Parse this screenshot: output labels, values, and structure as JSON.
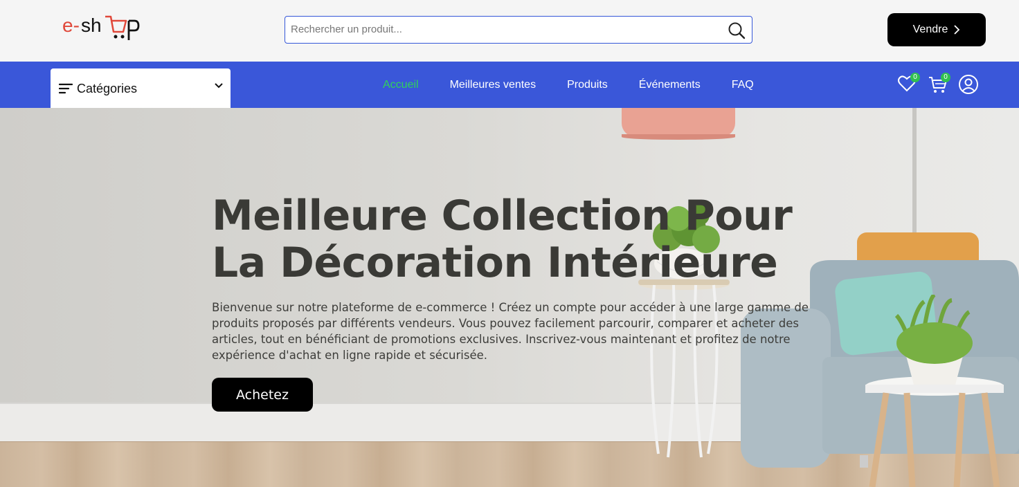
{
  "header": {
    "logo_text": "e-shop",
    "search": {
      "placeholder": "Rechercher un produit..."
    },
    "sell_label": "Vendre"
  },
  "nav": {
    "categories_label": "Catégories",
    "links": [
      {
        "label": "Accueil",
        "active": true
      },
      {
        "label": "Meilleures ventes",
        "active": false
      },
      {
        "label": "Produits",
        "active": false
      },
      {
        "label": "Événements",
        "active": false
      },
      {
        "label": "FAQ",
        "active": false
      }
    ],
    "wishlist_count": "0",
    "cart_count": "0"
  },
  "hero": {
    "title_line1": "Meilleure Collection Pour",
    "title_line2": "La Décoration Intérieure",
    "description": "Bienvenue sur notre plateforme de e-commerce ! Créez un compte pour accéder à une large gamme de produits proposés par différents vendeurs. Vous pouvez facilement parcourir, comparer et acheter des articles, tout en bénéficiant de promotions exclusives. Inscrivez-vous maintenant et profitez de notre expérience d'achat en ligne rapide et sécurisée.",
    "cta_label": "Achetez"
  },
  "colors": {
    "accent_blue": "#3a57d9",
    "active_green": "#30d35a",
    "button_black": "#000000",
    "logo_red": "#e0483a"
  }
}
